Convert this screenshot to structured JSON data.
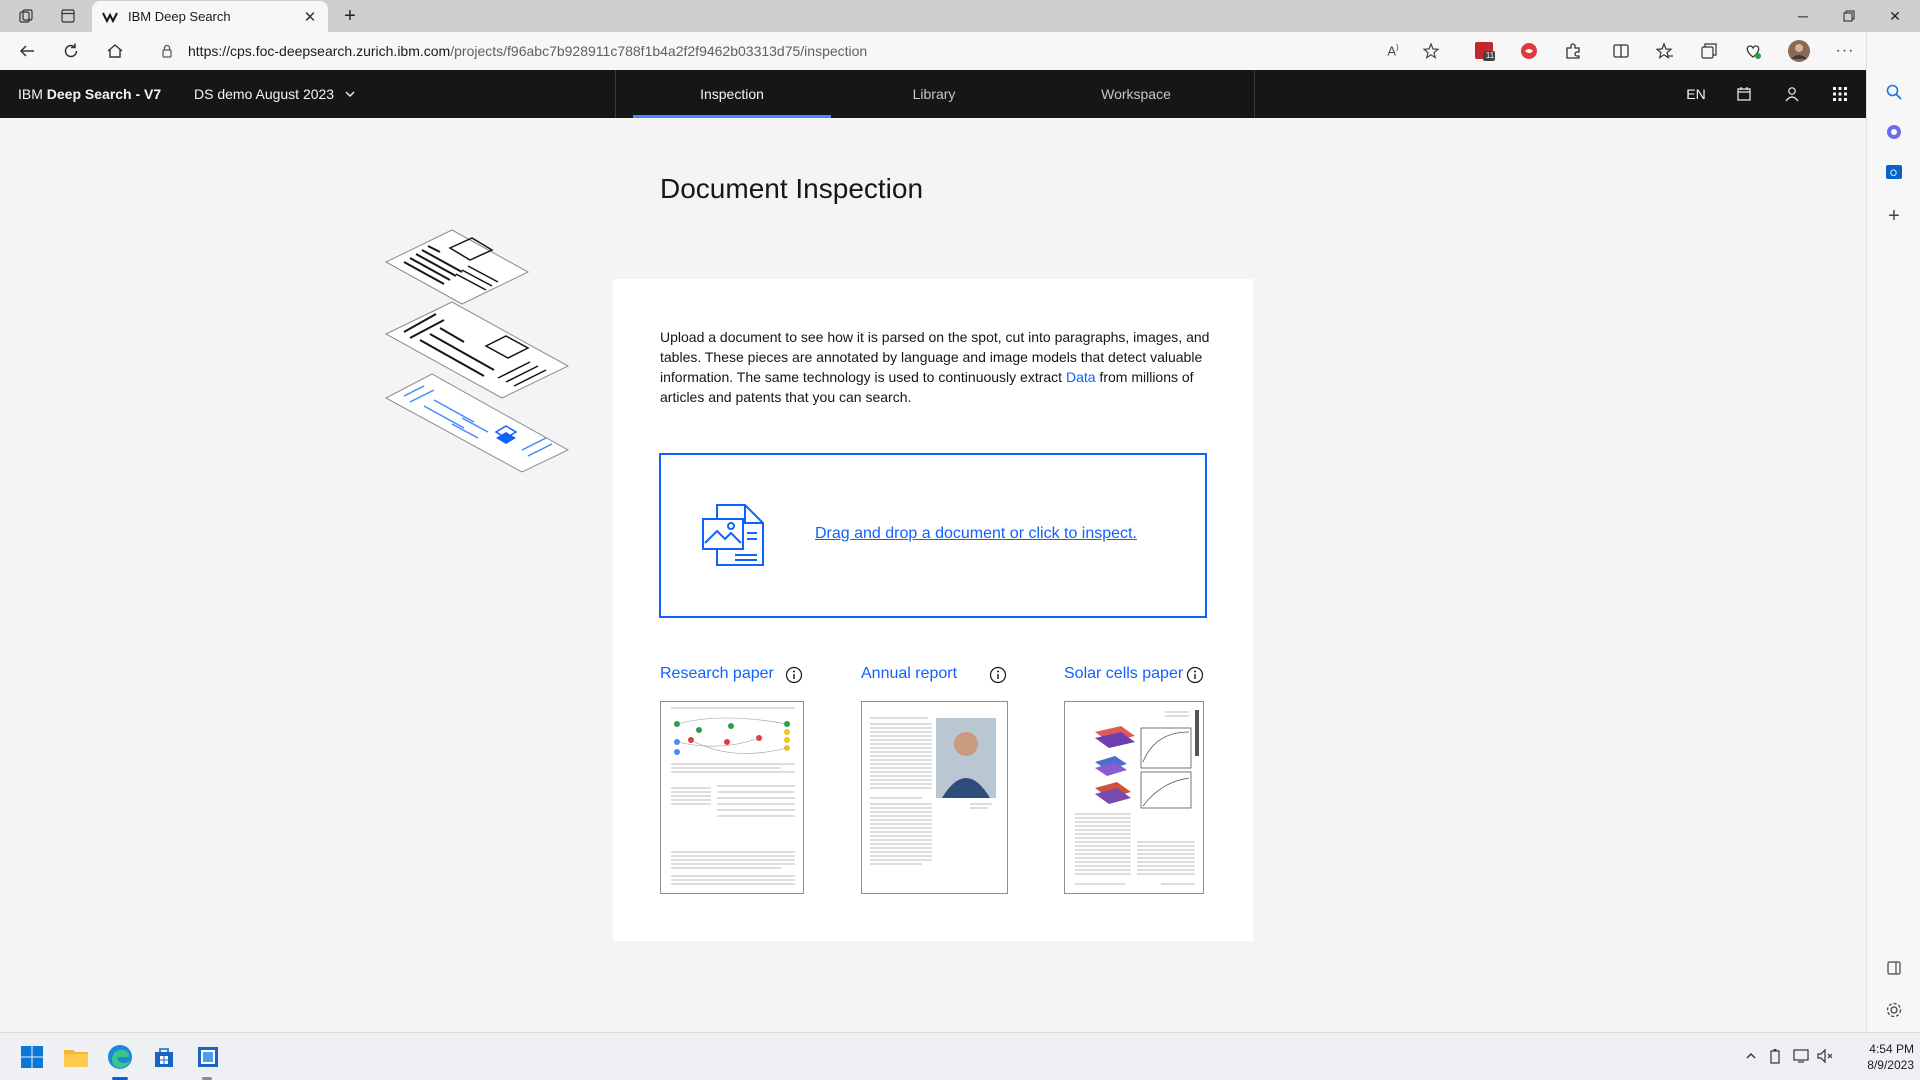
{
  "browser": {
    "tab_title": "IBM Deep Search",
    "url_host": "https://cps.foc-deepsearch.zurich.ibm.com",
    "url_path": "/projects/f96abc7b928911c788f1b4a2f2f9462b03313d75/inspection",
    "ext_badge": "11"
  },
  "app": {
    "brand_prefix": "IBM ",
    "brand_bold": "Deep Search",
    "brand_suffix": " - V7",
    "project": "DS demo August 2023",
    "nav": [
      {
        "label": "Inspection",
        "active": true
      },
      {
        "label": "Library",
        "active": false
      },
      {
        "label": "Workspace",
        "active": false
      }
    ],
    "lang": "EN"
  },
  "main": {
    "title": "Document Inspection",
    "intro_before": "Upload a document to see how it is parsed on the spot, cut into paragraphs, images, and tables. These pieces are annotated by language and image models that detect valuable information. The same technology is used to continuously extract ",
    "intro_link": "Data",
    "intro_after": " from millions of articles and patents that you can search.",
    "dropzone_text": "Drag and drop a document or click to inspect.",
    "samples": [
      {
        "label": "Research paper"
      },
      {
        "label": "Annual report"
      },
      {
        "label": "Solar cells paper"
      }
    ]
  },
  "taskbar": {
    "time": "4:54 PM",
    "date": "8/9/2023"
  },
  "colors": {
    "accent": "#0f62fe",
    "header_bg": "#161616",
    "nav_indicator": "#4589ff"
  }
}
